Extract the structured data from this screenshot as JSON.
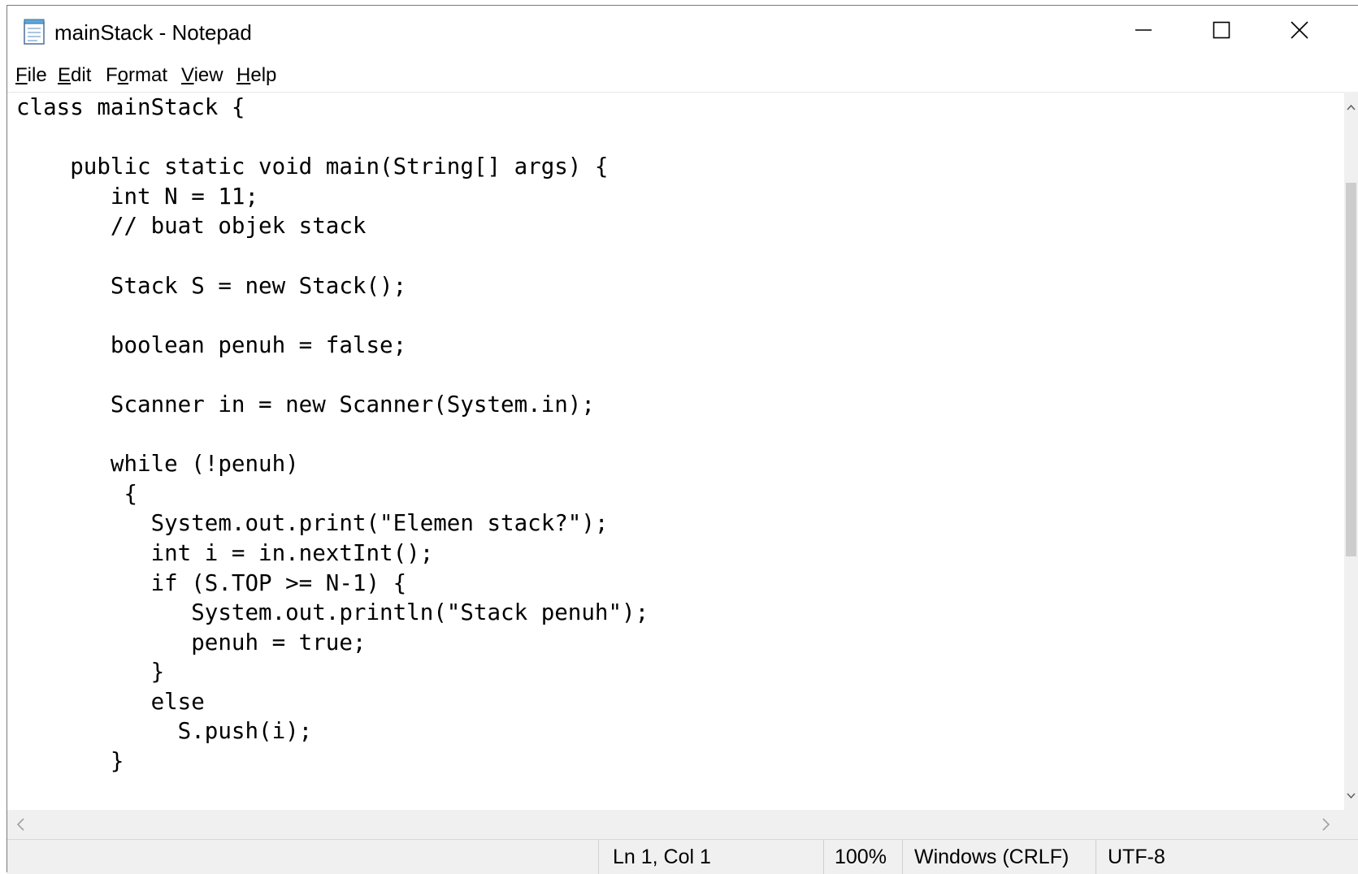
{
  "window": {
    "title": "mainStack - Notepad"
  },
  "menu": [
    {
      "accel": "F",
      "rest": "ile"
    },
    {
      "accel": "E",
      "rest": "dit"
    },
    {
      "pre": "F",
      "accel": "o",
      "rest": "rmat"
    },
    {
      "accel": "V",
      "rest": "iew"
    },
    {
      "accel": "H",
      "rest": "elp"
    }
  ],
  "editor": {
    "lines": [
      "class mainStack {",
      "",
      "    public static void main(String[] args) {",
      "       int N = 11;",
      "       // buat objek stack",
      "",
      "       Stack S = new Stack();",
      "",
      "       boolean penuh = false;",
      "",
      "       Scanner in = new Scanner(System.in);",
      "",
      "       while (!penuh)",
      "        {",
      "          System.out.print(\"Elemen stack?\");",
      "          int i = in.nextInt();",
      "          if (S.TOP >= N-1) {",
      "             System.out.println(\"Stack penuh\");",
      "             penuh = true;",
      "          }",
      "          else",
      "            S.push(i);",
      "       }"
    ]
  },
  "statusbar": {
    "position": "Ln 1, Col 1",
    "zoom": "100%",
    "line_ending": "Windows (CRLF)",
    "encoding": "UTF-8"
  },
  "icons": {
    "app": "notepad-icon",
    "minimize": "minimize-icon",
    "maximize": "maximize-icon",
    "close": "close-icon"
  }
}
